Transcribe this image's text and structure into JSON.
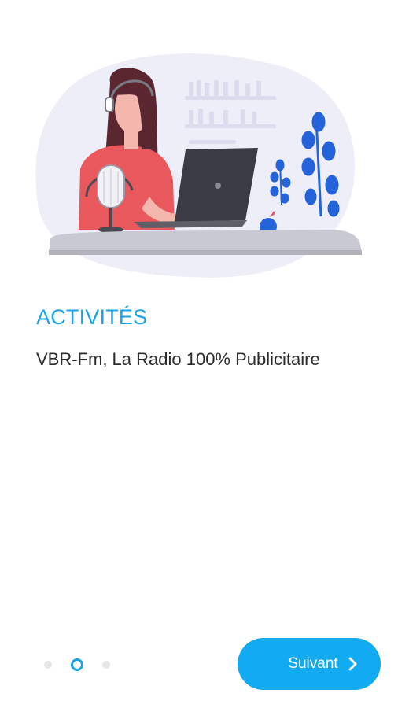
{
  "onboarding": {
    "title": "ACTIVITÉS",
    "subtitle": "VBR-Fm, La Radio 100% Publicitaire",
    "illustration": "podcast-recording-illustration",
    "pager": {
      "total": 3,
      "current": 2
    },
    "next_button": {
      "label": "Suivant",
      "icon": "chevron-right-icon"
    }
  },
  "colors": {
    "accent": "#1aa3e8",
    "button": "#12aaf0",
    "text": "#2b2b2b",
    "inactive_dot": "#e6e6e6"
  }
}
